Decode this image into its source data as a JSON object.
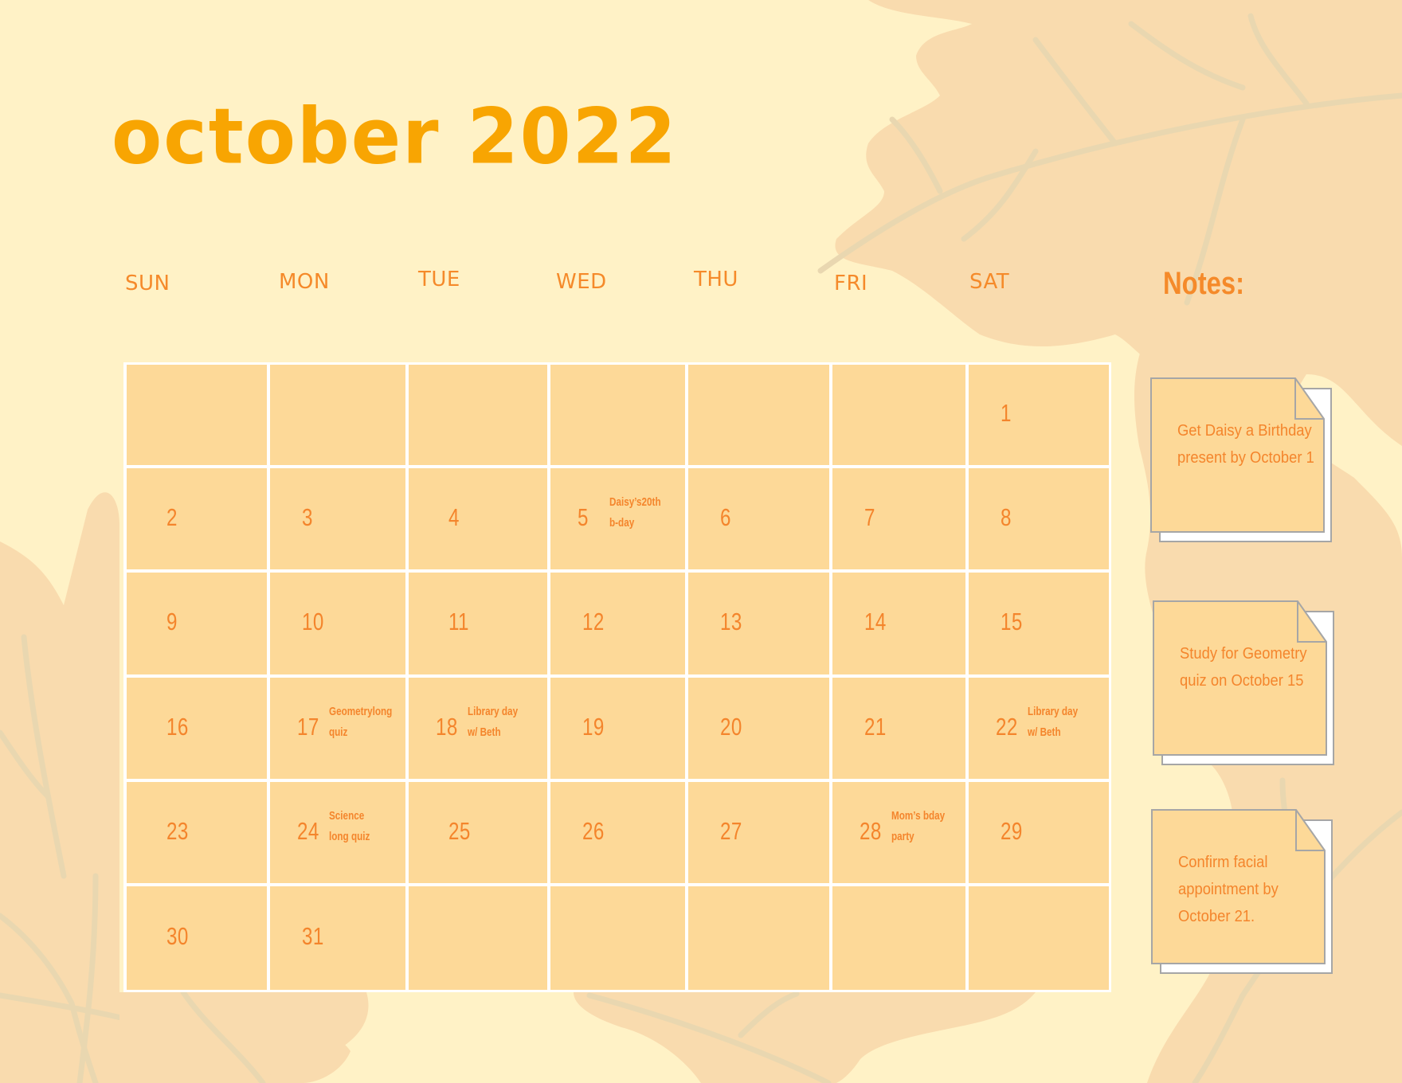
{
  "title": "october 2022",
  "colors": {
    "background": "#fff2c6",
    "cell": "#fdd998",
    "grid_lines": "#ffffff",
    "title": "#f8a502",
    "text": "#f4852c",
    "leaf": "#f9dbae",
    "leaf_vein": "#e9d7b0",
    "note_border": "#a6a6a6"
  },
  "weekdays": [
    "SUN",
    "MON",
    "TUE",
    "WED",
    "THU",
    "FRI",
    "SAT"
  ],
  "calendar": {
    "weeks": [
      [
        {
          "day": ""
        },
        {
          "day": ""
        },
        {
          "day": ""
        },
        {
          "day": ""
        },
        {
          "day": ""
        },
        {
          "day": ""
        },
        {
          "day": "1"
        }
      ],
      [
        {
          "day": "2"
        },
        {
          "day": "3"
        },
        {
          "day": "4"
        },
        {
          "day": "5",
          "event": "Daisy’s20th\nb-day"
        },
        {
          "day": "6"
        },
        {
          "day": "7"
        },
        {
          "day": "8"
        }
      ],
      [
        {
          "day": "9"
        },
        {
          "day": "10"
        },
        {
          "day": "11"
        },
        {
          "day": "12"
        },
        {
          "day": "13"
        },
        {
          "day": "14"
        },
        {
          "day": "15"
        }
      ],
      [
        {
          "day": "16"
        },
        {
          "day": "17",
          "event": "Geometrylong\nquiz"
        },
        {
          "day": "18",
          "event": "Library day\nw/ Beth"
        },
        {
          "day": "19"
        },
        {
          "day": "20"
        },
        {
          "day": "21"
        },
        {
          "day": "22",
          "event": "Library day\nw/ Beth"
        }
      ],
      [
        {
          "day": "23"
        },
        {
          "day": "24",
          "event": "Science\nlong quiz"
        },
        {
          "day": "25"
        },
        {
          "day": "26"
        },
        {
          "day": "27"
        },
        {
          "day": "28",
          "event": "Mom’s bday\nparty"
        },
        {
          "day": "29"
        }
      ],
      [
        {
          "day": "30"
        },
        {
          "day": "31"
        },
        {
          "day": ""
        },
        {
          "day": ""
        },
        {
          "day": ""
        },
        {
          "day": ""
        },
        {
          "day": ""
        }
      ]
    ]
  },
  "notes": {
    "heading": "Notes:",
    "items": [
      {
        "text": "Get Daisy a Birthday present by October 1"
      },
      {
        "text": "Study for Geometry quiz on October 15"
      },
      {
        "text": "Confirm facial appointment by October 21."
      }
    ]
  }
}
